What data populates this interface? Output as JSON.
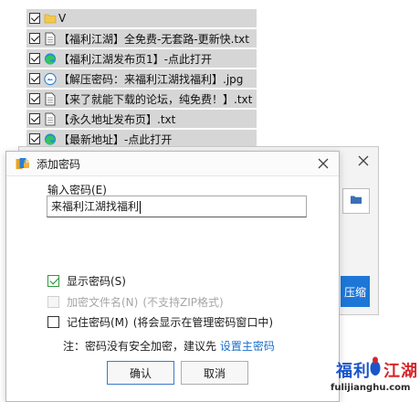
{
  "file_list": [
    {
      "name": "V",
      "icon": "folder-icon",
      "checked": true
    },
    {
      "name": "【福利江湖】全免费-无套路-更新快.txt",
      "icon": "text-file-icon",
      "checked": true
    },
    {
      "name": "【福利江湖发布页1】-点此打开",
      "icon": "edge-browser-icon",
      "checked": true
    },
    {
      "name": "【解压密码：来福利江湖找福利】.jpg",
      "icon": "jpg-file-icon",
      "checked": true
    },
    {
      "name": "【来了就能下载的论坛，纯免费！】.txt",
      "icon": "text-file-icon",
      "checked": true
    },
    {
      "name": "【永久地址发布页】.txt",
      "icon": "text-file-icon",
      "checked": true
    },
    {
      "name": "【最新地址】-点此打开",
      "icon": "edge-browser-icon",
      "checked": true
    }
  ],
  "back_dialog": {
    "button_fragment": "压缩"
  },
  "dialog": {
    "title": "添加密码",
    "password_label": "输入密码(E)",
    "password_value": "来福利江湖找福利",
    "show_password": {
      "label": "显示密码(S)",
      "checked": true,
      "enabled": true
    },
    "encrypt_filenames": {
      "label": "加密文件名(N)",
      "note": "(不支持ZIP格式)",
      "checked": false,
      "enabled": false
    },
    "remember_password": {
      "label": "记住密码(M)",
      "note": "(将会显示在管理密码窗口中)",
      "checked": false,
      "enabled": true
    },
    "notice_prefix": "注：密码没有安全加密，建议先 ",
    "notice_link": "设置主密码",
    "ok_label": "确认",
    "cancel_label": "取消"
  },
  "watermark": {
    "text_blue": "福利",
    "text_red": "江湖",
    "url": "fulijianghu.com"
  },
  "colors": {
    "accent": "#1e77d6",
    "link": "#1a6fc9",
    "check_green": "#1f8a2d",
    "row_bg": "#d6d6d6"
  }
}
